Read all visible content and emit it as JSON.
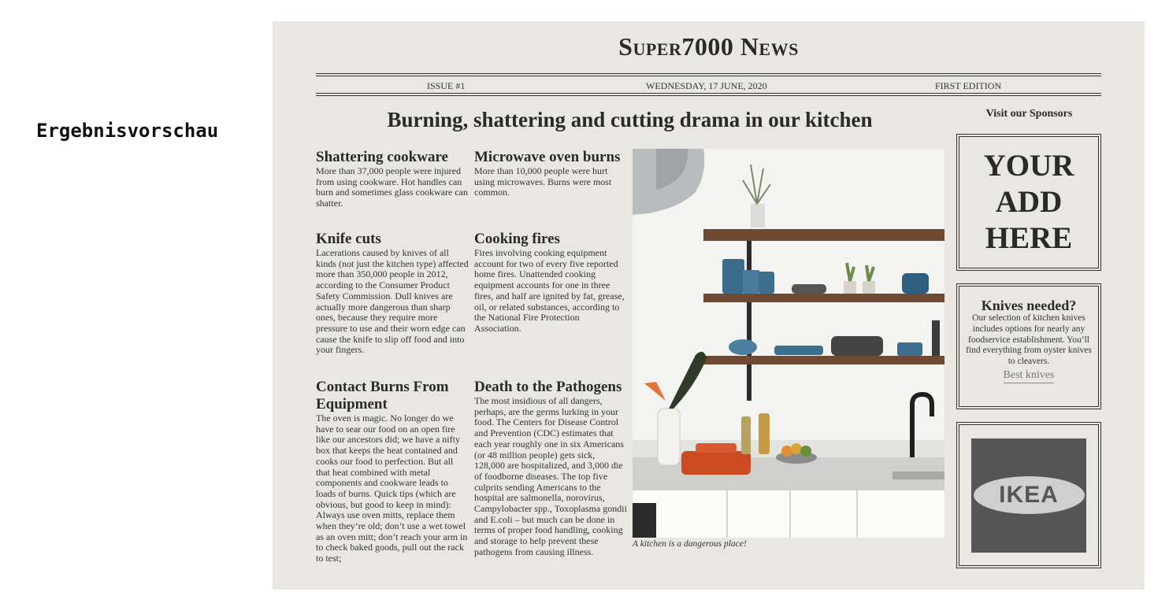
{
  "preview_label": "Ergebnisvorschau",
  "newspaper": {
    "name": "Super7000 News",
    "issue": "Issue #1",
    "date": "Wednesday, 17 June, 2020",
    "edition": "First Edition",
    "headline": "Burning, shattering and cutting drama in our kitchen"
  },
  "articles": [
    {
      "title": "Shattering cookware",
      "body": "More than 37,000 people were injured from using cookware. Hot handles can burn and sometimes glass cookware can shatter."
    },
    {
      "title": "Microwave oven burns",
      "body": "More than 10,000 people were hurt using microwaves. Burns were most common."
    },
    {
      "title": "Knife cuts",
      "body": "Lacerations caused by knives of all kinds (not just the kitchen type) affected more than 350,000 people in 2012, according to the Consumer Product Safety Commission. Dull knives are actually more dangerous than sharp ones, because they require more pressure to use and their worn edge can cause the knife to slip off food and into your fingers."
    },
    {
      "title": "Cooking fires",
      "body": "Fires involving cooking equipment account for two of every five reported home fires. Unattended cooking equipment accounts for one in three fires, and half are ignited by fat, grease, oil, or related substances, according to the National Fire Protection Association."
    },
    {
      "title": "Contact Burns From Equipment",
      "body": "The oven is magic. No longer do we have to sear our food on an open fire like our ancestors did; we have a nifty box that keeps the heat contained and cooks our food to perfection. But all that heat combined with metal components and cookware leads to loads of burns. Quick tips (which are obvious, but good to keep in mind): Always use oven mitts, replace them when they’re old; don’t use a wet towel as an oven mitt; don’t reach your arm in to check baked goods, pull out the rack to test;"
    },
    {
      "title": "Death to the Pathogens",
      "body": "The most insidious of all dangers, perhaps, are the germs lurking in your food. The Centers for Disease Control and Prevention (CDC) estimates that each year roughly one in six Americans (or 48 million people) gets sick, 128,000 are hospitalized, and 3,000 die of foodborne diseases. The top five culprits sending Americans to the hospital are salmonella, norovirus, Campylobacter spp., Toxoplasma gondii and E.coli – but much can be done in terms of proper food handling, cooking and storage to help prevent these pathogens from causing illness."
    }
  ],
  "photo": {
    "caption": "A kitchen is a dangerous place!"
  },
  "sidebar": {
    "title": "Visit our Sponsors",
    "ad_line1": "YOUR",
    "ad_line2": "ADD",
    "ad_line3": "HERE",
    "knives_title": "Knives needed?",
    "knives_body": "Our selection of kitchen knives includes options for nearly any foodservice establishment. You’ll find everything from oyster knives to cleavers.",
    "knives_link": "Best knives",
    "ikea_logo_text": "IKEA"
  }
}
